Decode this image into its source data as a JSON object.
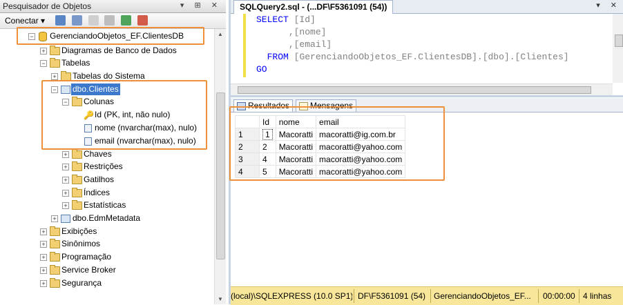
{
  "object_explorer": {
    "title": "Pesquisador de Objetos",
    "title_buttons": "▾ ⊞ ✕",
    "connect_label": "Conectar ▾",
    "tree": {
      "database": "GerenciandoObjetos_EF.ClientesDB",
      "diagrams": "Diagramas de Banco de Dados",
      "tables": "Tabelas",
      "system_tables": "Tabelas do Sistema",
      "clientes_table": "dbo.Clientes",
      "columns_folder": "Colunas",
      "col_id": "Id (PK, int, não nulo)",
      "col_nome": "nome (nvarchar(max), nulo)",
      "col_email": "email (nvarchar(max), nulo)",
      "keys": "Chaves",
      "constraints": "Restrições",
      "triggers": "Gatilhos",
      "indexes": "Índices",
      "statistics": "Estatísticas",
      "edm_table": "dbo.EdmMetadata",
      "views": "Exibições",
      "synonyms": "Sinônimos",
      "programming": "Programação",
      "service_broker": "Service Broker",
      "security": "Segurança"
    }
  },
  "query": {
    "tab_title": "SQLQuery2.sql - (...DF\\F5361091 (54))",
    "tab_buttons": "▾ ✕",
    "code": {
      "l1_kw": "SELECT",
      "l1_id": "[Id]",
      "l2_c": ",",
      "l2_id": "[nome]",
      "l3_c": ",",
      "l3_id": "[email]",
      "l4_kw": "FROM",
      "l4_id": "[GerenciandoObjetos_EF.ClientesDB]",
      "l4_dot1": ".",
      "l4_schema": "[dbo]",
      "l4_dot2": ".",
      "l4_table": "[Clientes]",
      "l5_kw": "GO"
    }
  },
  "results": {
    "tabs": [
      "Resultados",
      "Mensagens"
    ],
    "columns": [
      "Id",
      "nome",
      "email"
    ],
    "rows": [
      {
        "n": "1",
        "id": "1",
        "nome": "Macoratti",
        "email": "macoratti@ig.com.br"
      },
      {
        "n": "2",
        "id": "2",
        "nome": "Macoratti",
        "email": "macoratti@yahoo.com"
      },
      {
        "n": "3",
        "id": "4",
        "nome": "Macoratti",
        "email": "macoratti@yahoo.com"
      },
      {
        "n": "4",
        "id": "5",
        "nome": "Macoratti",
        "email": "macoratti@yahoo.com"
      }
    ]
  },
  "statusbar": {
    "server": "(local)\\SQLEXPRESS (10.0 SP1)",
    "user": "DF\\F5361091 (54)",
    "database": "GerenciandoObjetos_EF...",
    "time": "00:00:00",
    "rows": "4 linhas"
  },
  "colors": {
    "highlight": "#f08f3a",
    "selection": "#3c79cc",
    "keyword": "#0000ff",
    "statusbar": "#f8e79a"
  }
}
